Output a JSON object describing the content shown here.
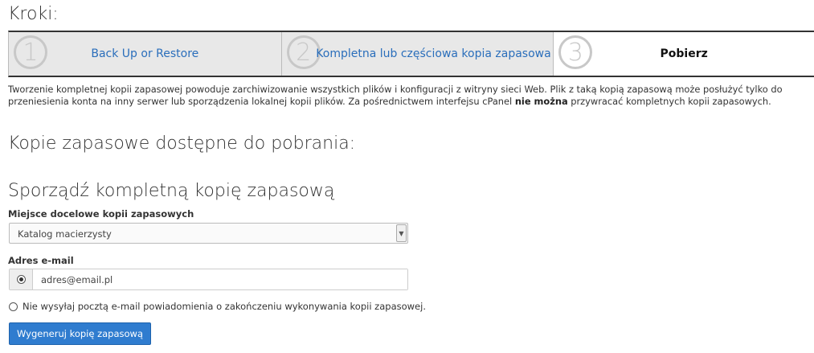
{
  "headings": {
    "steps_title": "Kroki:",
    "available": "Kopie zapasowe dostępne do pobrania:",
    "full_backup": "Sporządź kompletną kopię zapasową"
  },
  "steps": [
    {
      "number": "1",
      "label": "Back Up or Restore"
    },
    {
      "number": "2",
      "label": "Kompletna lub częściowa kopia zapasowa"
    },
    {
      "number": "3",
      "label": "Pobierz"
    }
  ],
  "description": {
    "part1": "Tworzenie kompletnej kopii zapasowej powoduje zarchiwizowanie wszystkich plików i konfiguracji z witryny sieci Web. Plik z taką kopią zapasową może posłużyć tylko do przeniesienia konta na inny serwer lub sporządzenia lokalnej kopii plików. Za pośrednictwem interfejsu cPanel ",
    "bold": "nie można",
    "part2": " przywracać kompletnych kopii zapasowych."
  },
  "form": {
    "destination_label": "Miejsce docelowe kopii zapasowych",
    "destination_value": "Katalog macierzysty",
    "email_label": "Adres e-mail",
    "email_value": "adres@email.pl",
    "no_email_label": "Nie wysyłaj pocztą e-mail powiadomienia o zakończeniu wykonywania kopii zapasowej.",
    "generate_button": "Wygeneruj kopię zapasową"
  }
}
